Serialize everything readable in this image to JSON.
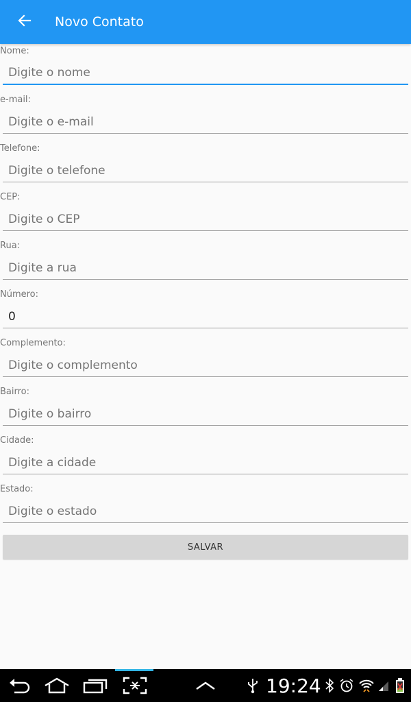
{
  "appbar": {
    "title": "Novo Contato",
    "color": "#2196f3"
  },
  "form": {
    "fields": [
      {
        "label": "Nome:",
        "placeholder": "Digite o nome"
      },
      {
        "label": "e-mail:",
        "placeholder": "Digite o e-mail"
      },
      {
        "label": "Telefone:",
        "placeholder": "Digite o telefone"
      },
      {
        "label": "CEP:",
        "placeholder": "Digite o CEP"
      },
      {
        "label": "Rua:",
        "placeholder": "Digite a rua"
      },
      {
        "label": "Número:",
        "value": "0"
      },
      {
        "label": "Complemento:",
        "placeholder": "Digite o complemento"
      },
      {
        "label": "Bairro:",
        "placeholder": "Digite o bairro"
      },
      {
        "label": "Cidade:",
        "placeholder": "Digite a cidade"
      },
      {
        "label": "Estado:",
        "placeholder": "Digite o estado"
      }
    ],
    "save_label": "SALVAR"
  },
  "system_bar": {
    "time": "19:24",
    "icons": [
      "back-icon",
      "home-icon",
      "recent-apps-icon",
      "screenshot-icon",
      "menu-up-icon",
      "usb-icon",
      "bluetooth-icon",
      "alarm-icon",
      "wifi-icon",
      "signal-icon",
      "battery-icon"
    ]
  }
}
